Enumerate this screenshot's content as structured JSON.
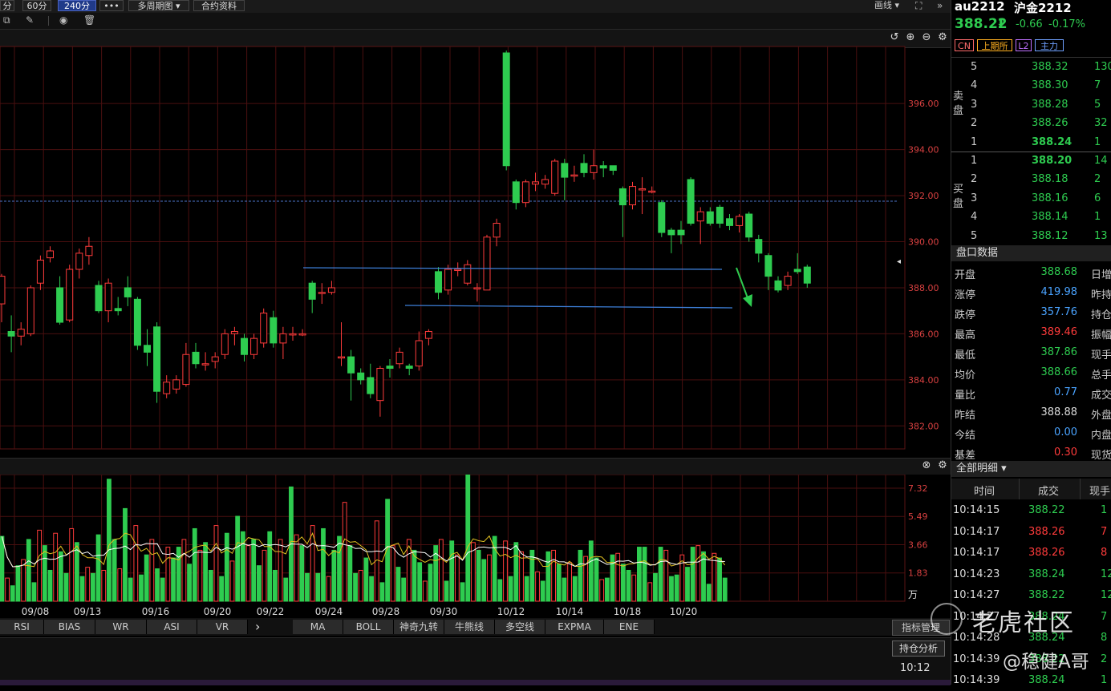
{
  "toolbar": {
    "buttons": [
      "分",
      "60分",
      "240分",
      "•••",
      "多周期图 ▾",
      "合约资料"
    ],
    "draw_label": "画线 ▾",
    "active_index": 2
  },
  "chart_header": {
    "icons": [
      "undo-icon",
      "zoom-in-icon",
      "zoom-out-icon",
      "settings-icon"
    ]
  },
  "colors": {
    "up": "#ff3b3b",
    "down": "#2ecc50",
    "grid": "#4a0f0f",
    "axis_text": "#d84040"
  },
  "price_axis": {
    "labels": [
      "396.00",
      "394.00",
      "392.00",
      "390.00",
      "388.00",
      "386.00",
      "384.00",
      "382.00"
    ],
    "current_marker": "◂"
  },
  "volume_axis": {
    "labels": [
      "7.32",
      "5.49",
      "3.66",
      "1.83"
    ],
    "unit": "万"
  },
  "x_axis": {
    "labels": [
      "09/08",
      "09/13",
      "09/16",
      "09/20",
      "09/22",
      "09/24",
      "09/28",
      "09/30",
      "10/12",
      "10/14",
      "10/18",
      "10/20"
    ]
  },
  "indicator_tabs": {
    "left": [
      "RSI",
      "BIAS",
      "WR",
      "ASI",
      "VR"
    ],
    "arrow": "›",
    "right": [
      "MA",
      "BOLL",
      "神奇九转",
      "牛熊线",
      "多空线",
      "EXPMA",
      "ENE"
    ],
    "manage_label": "指标管理",
    "position_label": "持仓分析",
    "time_label": "10:12"
  },
  "quote": {
    "symbol": "au2212",
    "name": "沪金2212",
    "price": "388.22",
    "arrow": "⬇",
    "change": "-0.66",
    "change_pct": "-0.17%",
    "badges": [
      "CN",
      "上期所",
      "L2",
      "主力"
    ]
  },
  "orderbook": {
    "sell_label": "卖盘",
    "buy_label": "买盘",
    "asks": [
      {
        "level": "5",
        "price": "388.32",
        "vol": "130"
      },
      {
        "level": "4",
        "price": "388.30",
        "vol": "7"
      },
      {
        "level": "3",
        "price": "388.28",
        "vol": "5"
      },
      {
        "level": "2",
        "price": "388.26",
        "vol": "32"
      },
      {
        "level": "1",
        "price": "388.24",
        "vol": "1"
      }
    ],
    "bids": [
      {
        "level": "1",
        "price": "388.20",
        "vol": "14"
      },
      {
        "level": "2",
        "price": "388.18",
        "vol": "2"
      },
      {
        "level": "3",
        "price": "388.16",
        "vol": "6"
      },
      {
        "level": "4",
        "price": "388.14",
        "vol": "1"
      },
      {
        "level": "5",
        "price": "388.12",
        "vol": "13"
      }
    ]
  },
  "stats": {
    "title": "盘口数据",
    "rows": [
      {
        "label": "开盘",
        "value": "388.68",
        "extra": "日增"
      },
      {
        "label": "涨停",
        "value": "419.98",
        "extra": "昨持"
      },
      {
        "label": "跌停",
        "value": "357.76",
        "extra": "持仓"
      },
      {
        "label": "最高",
        "value": "389.46",
        "extra": "振幅"
      },
      {
        "label": "最低",
        "value": "387.86",
        "extra": "现手"
      },
      {
        "label": "均价",
        "value": "388.66",
        "extra": "总手"
      },
      {
        "label": "量比",
        "value": "0.77",
        "extra": "成交"
      },
      {
        "label": "昨结",
        "value": "388.88",
        "extra": "外盘"
      },
      {
        "label": "今结",
        "value": "0.00",
        "extra": "内盘"
      },
      {
        "label": "基差",
        "value": "0.30",
        "extra": "现货"
      }
    ]
  },
  "trades": {
    "title": "全部明细 ▾",
    "headers": [
      "时间",
      "成交",
      "现手"
    ],
    "rows": [
      {
        "time": "10:14:15",
        "price": "388.22",
        "vol": "1"
      },
      {
        "time": "10:14:17",
        "price": "388.26",
        "vol": "7"
      },
      {
        "time": "10:14:17",
        "price": "388.26",
        "vol": "8"
      },
      {
        "time": "10:14:23",
        "price": "388.24",
        "vol": "12"
      },
      {
        "time": "10:14:27",
        "price": "388.22",
        "vol": "12"
      },
      {
        "time": "10:14:27",
        "price": "388.24",
        "vol": "7"
      },
      {
        "time": "10:14:28",
        "price": "388.24",
        "vol": "8"
      },
      {
        "time": "10:14:39",
        "price": "388.22",
        "vol": "2"
      },
      {
        "time": "10:14:39",
        "price": "388.24",
        "vol": "1"
      }
    ]
  },
  "watermark": {
    "brand": "老虎社区",
    "author": "@稳健A哥"
  },
  "chart_data": {
    "type": "candlestick",
    "price_range": [
      381,
      398.2
    ],
    "volume_range": [
      0,
      8.2
    ],
    "candles": [
      [
        387.3,
        388.5,
        388.6,
        386.5
      ],
      [
        386.1,
        385.9,
        386.8,
        385.2
      ],
      [
        385.9,
        386.2,
        386.5,
        385.5
      ],
      [
        386.0,
        388.0,
        388.1,
        385.9
      ],
      [
        388.2,
        389.2,
        389.4,
        387.9
      ],
      [
        389.3,
        389.6,
        389.8,
        389.1
      ],
      [
        388.0,
        386.5,
        388.5,
        386.4
      ],
      [
        386.6,
        388.8,
        389.0,
        386.5
      ],
      [
        388.8,
        389.5,
        389.7,
        388.4
      ],
      [
        389.4,
        389.8,
        390.2,
        389.0
      ],
      [
        388.1,
        387.0,
        388.3,
        386.9
      ],
      [
        387.0,
        388.2,
        388.4,
        386.5
      ],
      [
        387.1,
        387.0,
        387.6,
        386.8
      ],
      [
        388.0,
        387.6,
        388.5,
        387.2
      ],
      [
        387.5,
        385.5,
        387.6,
        385.3
      ],
      [
        385.5,
        385.2,
        386.2,
        384.6
      ],
      [
        386.3,
        383.5,
        386.5,
        383.0
      ],
      [
        383.4,
        383.9,
        384.2,
        383.2
      ],
      [
        383.6,
        384.0,
        384.2,
        383.4
      ],
      [
        383.8,
        385.1,
        385.6,
        383.7
      ],
      [
        385.2,
        384.7,
        385.6,
        384.5
      ],
      [
        384.7,
        384.7,
        385.2,
        384.4
      ],
      [
        384.8,
        385.0,
        385.2,
        384.5
      ],
      [
        385.1,
        386.0,
        386.2,
        384.9
      ],
      [
        386.0,
        386.1,
        386.3,
        385.5
      ],
      [
        385.8,
        385.1,
        386.0,
        384.8
      ],
      [
        385.1,
        385.8,
        386.0,
        384.9
      ],
      [
        385.6,
        386.9,
        387.1,
        385.4
      ],
      [
        386.7,
        385.6,
        387.0,
        385.4
      ],
      [
        385.6,
        386.0,
        386.3,
        384.9
      ],
      [
        386.0,
        386.0,
        386.3,
        385.7
      ],
      [
        386.0,
        386.0,
        386.2,
        385.9
      ],
      [
        388.2,
        387.5,
        388.3,
        386.9
      ],
      [
        387.8,
        387.8,
        388.2,
        387.3
      ],
      [
        387.8,
        388.0,
        388.3,
        387.7
      ],
      [
        385.0,
        385.0,
        386.5,
        384.6
      ],
      [
        385.0,
        384.3,
        385.3,
        383.1
      ],
      [
        384.3,
        384.0,
        384.5,
        383.8
      ],
      [
        384.1,
        383.4,
        384.7,
        383.2
      ],
      [
        383.1,
        384.5,
        384.6,
        382.4
      ],
      [
        384.6,
        384.5,
        384.9,
        384.1
      ],
      [
        384.7,
        385.2,
        385.4,
        384.5
      ],
      [
        384.6,
        384.5,
        384.7,
        384.2
      ],
      [
        384.6,
        385.7,
        386.1,
        384.4
      ],
      [
        385.8,
        386.1,
        386.2,
        385.5
      ],
      [
        388.7,
        387.8,
        388.9,
        387.5
      ],
      [
        387.9,
        388.8,
        389.0,
        387.7
      ],
      [
        388.8,
        388.8,
        389.1,
        388.5
      ],
      [
        388.2,
        389.0,
        389.2,
        388.1
      ],
      [
        388.0,
        388.0,
        388.2,
        387.4
      ],
      [
        387.9,
        390.2,
        390.3,
        387.9
      ],
      [
        390.2,
        390.8,
        391.0,
        389.8
      ],
      [
        398.2,
        393.3,
        398.3,
        393.1
      ],
      [
        392.6,
        391.7,
        392.7,
        391.4
      ],
      [
        391.7,
        392.6,
        392.7,
        391.5
      ],
      [
        392.5,
        392.6,
        393.0,
        392.2
      ],
      [
        392.5,
        392.7,
        392.9,
        392.3
      ],
      [
        392.1,
        393.5,
        393.6,
        392.0
      ],
      [
        393.4,
        392.8,
        393.6,
        391.8
      ],
      [
        392.9,
        392.9,
        393.3,
        392.6
      ],
      [
        393.4,
        393.0,
        393.8,
        392.8
      ],
      [
        393.0,
        393.3,
        394.0,
        392.7
      ],
      [
        393.3,
        393.2,
        393.5,
        392.8
      ],
      [
        393.3,
        393.1,
        393.3,
        392.9
      ],
      [
        392.3,
        391.6,
        392.4,
        390.2
      ],
      [
        391.6,
        392.4,
        392.6,
        391.4
      ],
      [
        392.3,
        392.3,
        392.8,
        391.2
      ],
      [
        392.2,
        392.2,
        392.4,
        392.1
      ],
      [
        391.7,
        390.4,
        391.8,
        390.2
      ],
      [
        390.5,
        390.3,
        390.6,
        389.5
      ],
      [
        390.5,
        390.3,
        390.9,
        389.9
      ],
      [
        392.7,
        390.8,
        392.8,
        390.7
      ],
      [
        390.9,
        391.3,
        391.5,
        389.9
      ],
      [
        391.3,
        390.8,
        391.5,
        390.7
      ],
      [
        391.5,
        390.8,
        391.6,
        390.6
      ],
      [
        391.0,
        390.7,
        391.2,
        390.5
      ],
      [
        390.7,
        391.1,
        391.2,
        390.4
      ],
      [
        391.2,
        390.2,
        391.3,
        390.0
      ],
      [
        390.1,
        389.5,
        390.3,
        389.1
      ],
      [
        389.4,
        388.5,
        389.5,
        387.9
      ],
      [
        388.3,
        387.9,
        388.5,
        387.8
      ],
      [
        388.1,
        388.5,
        388.7,
        387.9
      ],
      [
        388.8,
        388.7,
        389.5,
        388.6
      ],
      [
        388.9,
        388.2,
        389.0,
        388.0
      ]
    ],
    "volumes": [
      4.2,
      1.5,
      1.0,
      2.3,
      2.7,
      4.0,
      1.2,
      4.6,
      3.6,
      2.0,
      4.4,
      3.2,
      1.8,
      4.7,
      3.8,
      1.6,
      2.2,
      1.8,
      4.3,
      2.0,
      7.9,
      4.0,
      2.1,
      6.0,
      1.5,
      4.9,
      1.7,
      3.0,
      4.0,
      2.1,
      1.5,
      3.5,
      2.8,
      3.5,
      4.0,
      2.4,
      4.7,
      3.3,
      3.8,
      2.0,
      4.9,
      1.6,
      4.4,
      2.6,
      5.5,
      4.5,
      3.6,
      4.0,
      2.3,
      3.3,
      4.5,
      2.0,
      4.0,
      1.5,
      7.4,
      4.3,
      3.6,
      1.8,
      4.9,
      1.8,
      4.7,
      1.6,
      3.3,
      4.2,
      6.4,
      3.6,
      1.8,
      2.0,
      2.8,
      1.6,
      5.2,
      1.2,
      6.6,
      3.6,
      2.2,
      1.5,
      4.0,
      3.3,
      2.5,
      1.3,
      2.4,
      3.6,
      4.0,
      1.3,
      3.9,
      3.0,
      1.2,
      8.3,
      3.8,
      3.3,
      2.7,
      3.0,
      4.2,
      1.4,
      3.9,
      1.6,
      3.8,
      3.2,
      1.6,
      3.3,
      1.9,
      1.3,
      3.2,
      3.3,
      2.4,
      1.5,
      2.5,
      1.6,
      3.3,
      2.9,
      3.9,
      2.8,
      1.4,
      1.5,
      3.0,
      3.1,
      2.4,
      2.0,
      1.7,
      3.5,
      3.5,
      1.2,
      1.8,
      3.5,
      3.3,
      1.6,
      1.7,
      3.0,
      2.2,
      3.5,
      3.6,
      3.2,
      1.1,
      3.1,
      2.8,
      1.5
    ]
  }
}
